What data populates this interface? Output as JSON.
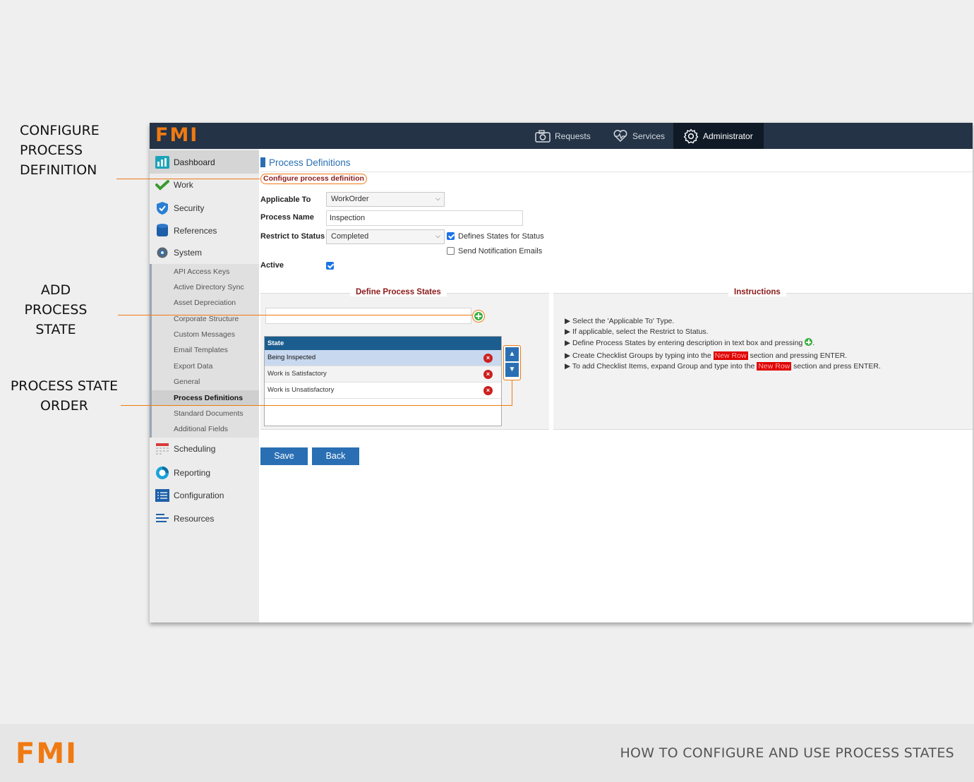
{
  "callouts": {
    "configure": [
      "CONFIGURE",
      "PROCESS",
      "DEFINITION"
    ],
    "add": [
      "ADD",
      "PROCESS",
      "STATE"
    ],
    "order": [
      "PROCESS STATE",
      "ORDER"
    ]
  },
  "footer": {
    "brand": "FMI",
    "title": "HOW TO CONFIGURE AND USE PROCESS STATES"
  },
  "app": {
    "brand": "FMI",
    "nav": [
      {
        "label": "Requests",
        "icon": "camera-icon"
      },
      {
        "label": "Services",
        "icon": "heartbeat-icon"
      },
      {
        "label": "Administrator",
        "icon": "gear-icon",
        "active": true
      }
    ]
  },
  "sidebar": {
    "items": [
      {
        "label": "Dashboard",
        "icon": "dashboard-icon",
        "active": true
      },
      {
        "label": "Work",
        "icon": "checkmark-icon"
      },
      {
        "label": "Security",
        "icon": "shield-icon"
      },
      {
        "label": "References",
        "icon": "database-icon"
      },
      {
        "label": "System",
        "icon": "gear-icon"
      },
      {
        "label": "Scheduling",
        "icon": "calendar-icon"
      },
      {
        "label": "Reporting",
        "icon": "pie-chart-icon"
      },
      {
        "label": "Configuration",
        "icon": "list-icon"
      },
      {
        "label": "Resources",
        "icon": "lines-icon"
      }
    ],
    "system_sub": [
      "API Access Keys",
      "Active Directory Sync",
      "Asset Depreciation",
      "Corporate Structure",
      "Custom Messages",
      "Email Templates",
      "Export Data",
      "General",
      "Process Definitions",
      "Standard Documents",
      "Additional Fields"
    ],
    "system_sub_active": "Process Definitions"
  },
  "main": {
    "title": "Process Definitions",
    "subtitle": "Configure process definition",
    "form": {
      "applicable_to_label": "Applicable To",
      "applicable_to_value": "WorkOrder",
      "process_name_label": "Process Name",
      "process_name_value": "Inspection",
      "restrict_label": "Restrict to Status",
      "restrict_value": "Completed",
      "defines_states_label": "Defines States for Status",
      "defines_states_checked": true,
      "send_notification_label": "Send Notification Emails",
      "send_notification_checked": false,
      "active_label": "Active",
      "active_checked": true
    },
    "states_panel": {
      "heading": "Define Process States",
      "new_state_value": "",
      "column": "State",
      "rows": [
        "Being Inspected",
        "Work is Satisfactory",
        "Work is Unsatisfactory"
      ],
      "selected_row": "Being Inspected"
    },
    "instructions": {
      "heading": "Instructions",
      "lines": [
        {
          "text": "Select the 'Applicable To' Type."
        },
        {
          "text": "If applicable, select the Restrict to Status."
        },
        {
          "text": "Define Process States by entering description in text box and pressing",
          "suffix": "."
        },
        {
          "text": "Create Checklist Groups by typing into the",
          "highlight": "New Row",
          "suffix": "section and pressing ENTER."
        },
        {
          "text": "To add Checklist Items, expand Group and type into the",
          "highlight": "New Row",
          "suffix": "section and press ENTER."
        }
      ]
    },
    "buttons": {
      "save": "Save",
      "back": "Back"
    }
  }
}
